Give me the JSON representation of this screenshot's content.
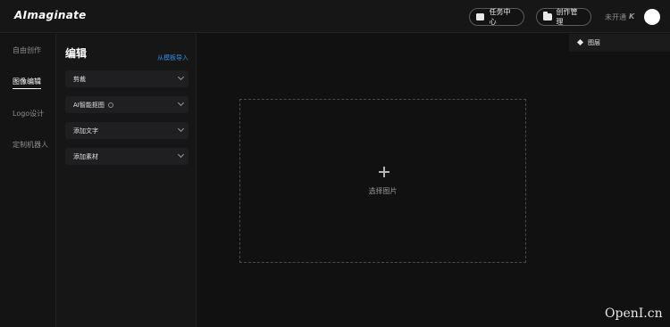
{
  "header": {
    "logo": "AImaginate",
    "tasks_label": "任务中心",
    "manage_label": "创作管理",
    "status_text": "未开通",
    "vip_mark": "K"
  },
  "nav": {
    "items": [
      {
        "label": "自由创作"
      },
      {
        "label": "图像编辑"
      },
      {
        "label": "Logo设计"
      },
      {
        "label": "定制机器人"
      }
    ]
  },
  "panel": {
    "title": "编辑",
    "template_link": "从模板导入",
    "rows": [
      {
        "label": "剪裁"
      },
      {
        "label": "AI智能抠图"
      },
      {
        "label": "添加文字"
      },
      {
        "label": "添加素材"
      }
    ]
  },
  "canvas": {
    "select_label": "选择图片",
    "layers_label": "图层"
  },
  "watermark": "OpenI.cn"
}
